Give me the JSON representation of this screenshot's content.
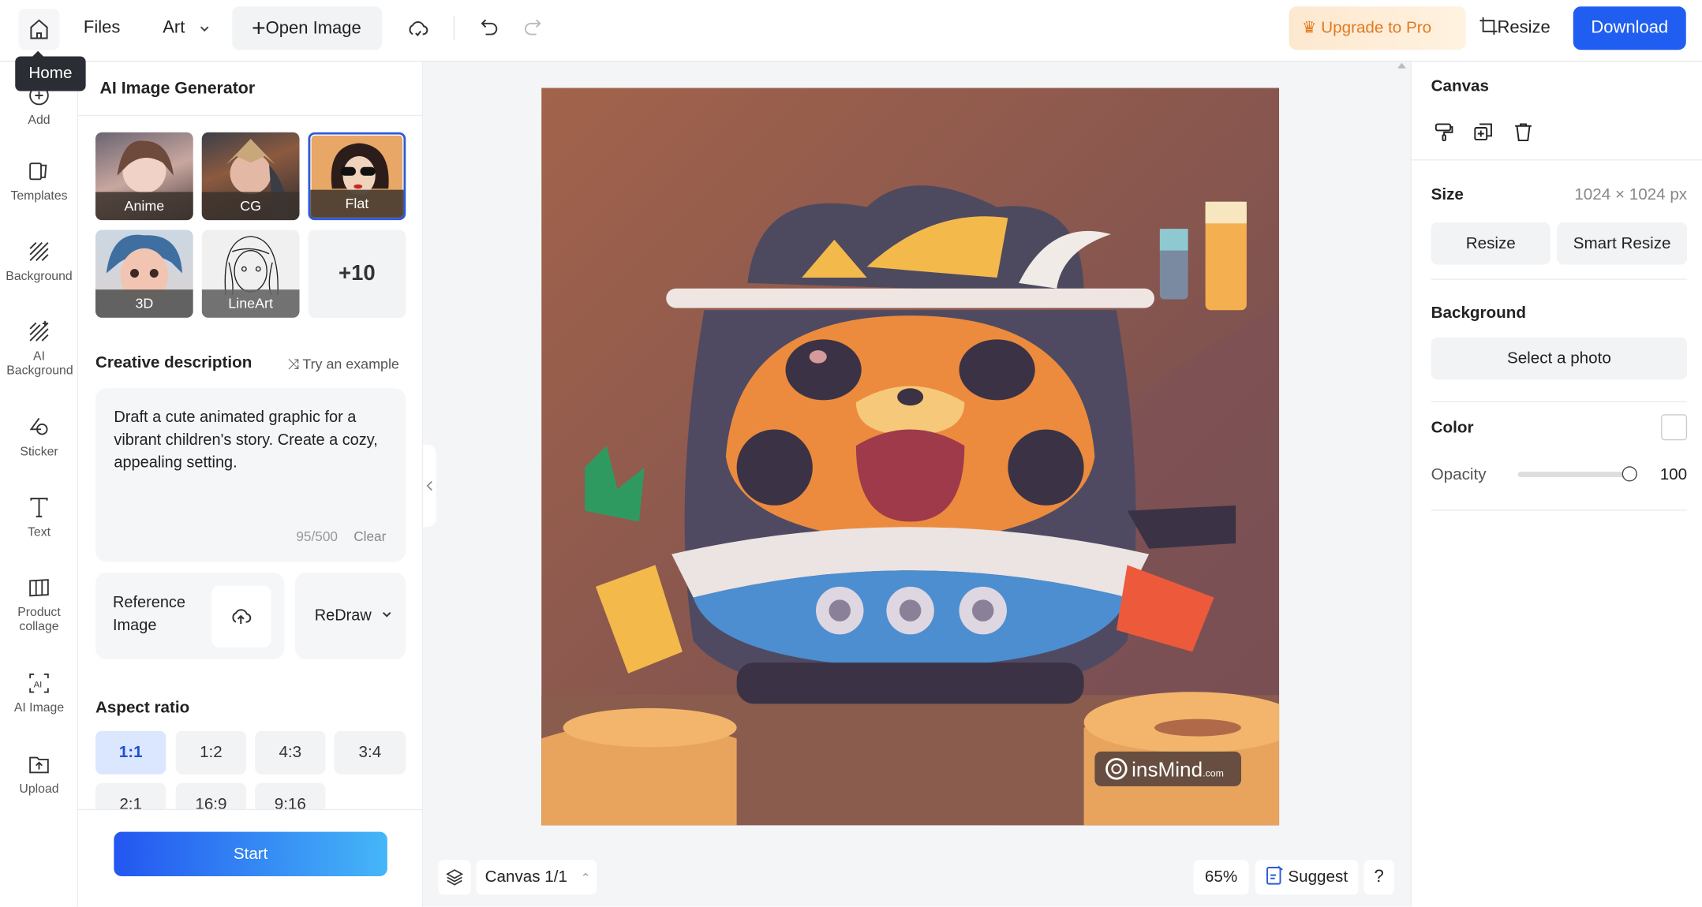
{
  "topbar": {
    "home_tooltip": "Home",
    "files": "Files",
    "art": "Art",
    "open_image": "Open Image",
    "upgrade": "Upgrade to Pro",
    "resize": "Resize",
    "download": "Download"
  },
  "rail": {
    "items": [
      {
        "label": "Add",
        "icon": "plus-circle-icon"
      },
      {
        "label": "Templates",
        "icon": "templates-icon"
      },
      {
        "label": "Background",
        "icon": "background-icon"
      },
      {
        "label": "AI Background",
        "icon": "ai-background-icon"
      },
      {
        "label": "Sticker",
        "icon": "sticker-icon"
      },
      {
        "label": "Text",
        "icon": "text-icon"
      },
      {
        "label": "Product collage",
        "icon": "collage-icon"
      },
      {
        "label": "AI Image",
        "icon": "ai-image-icon"
      },
      {
        "label": "Upload",
        "icon": "upload-icon"
      }
    ]
  },
  "panel": {
    "title": "AI Image Generator",
    "styles": [
      {
        "label": "Anime",
        "selected": false
      },
      {
        "label": "CG",
        "selected": false
      },
      {
        "label": "Flat",
        "selected": true
      },
      {
        "label": "3D",
        "selected": false
      },
      {
        "label": "LineArt",
        "selected": false
      }
    ],
    "more_styles": "+10",
    "creative_title": "Creative description",
    "try_example": "Try an example",
    "description": "Draft a cute animated graphic for a vibrant children's story. Create a cozy, appealing setting.",
    "char_count": "95/500",
    "clear": "Clear",
    "reference_image": "Reference Image",
    "redraw": "ReDraw",
    "aspect_title": "Aspect ratio",
    "ratios": [
      "1:1",
      "1:2",
      "4:3",
      "3:4",
      "2:1",
      "16:9",
      "9:16"
    ],
    "selected_ratio": "1:1",
    "start": "Start"
  },
  "canvas": {
    "watermark": "insMind.com",
    "page_label": "Canvas 1/1",
    "zoom": "65%",
    "suggest": "Suggest",
    "help": "?"
  },
  "right": {
    "canvas_title": "Canvas",
    "size_title": "Size",
    "size_value": "1024 × 1024 px",
    "resize": "Resize",
    "smart_resize": "Smart Resize",
    "background_title": "Background",
    "select_photo": "Select a photo",
    "color_title": "Color",
    "color_value": "#ffffff",
    "opacity_label": "Opacity",
    "opacity_value": "100"
  },
  "colors": {
    "accent": "#1f5ef0",
    "upgrade_text": "#e07a1f",
    "selected_ratio_bg": "#dbe6ff"
  }
}
